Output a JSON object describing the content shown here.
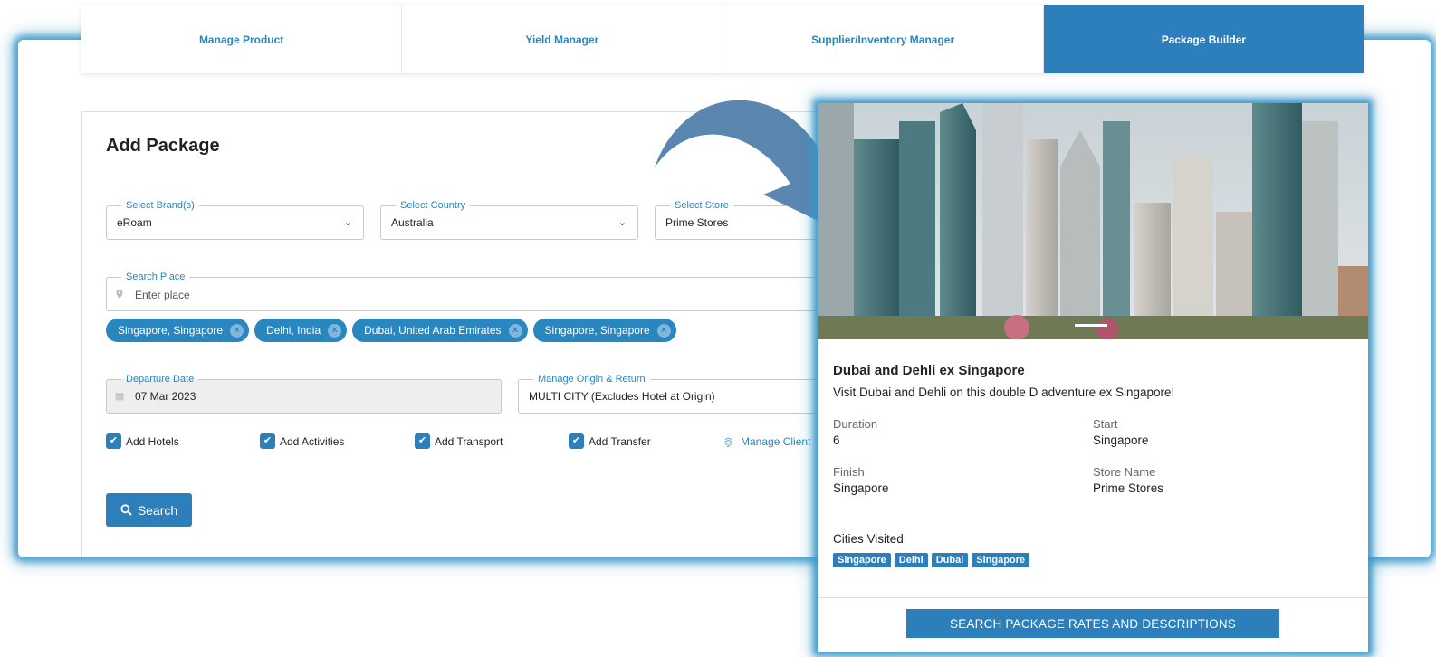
{
  "tabs": [
    {
      "label": "Manage Product"
    },
    {
      "label": "Yield Manager"
    },
    {
      "label": "Supplier/Inventory Manager"
    },
    {
      "label": "Package Builder",
      "active": true
    }
  ],
  "form": {
    "title": "Add Package",
    "brand": {
      "label": "Select Brand(s)",
      "value": "eRoam"
    },
    "country": {
      "label": "Select Country",
      "value": "Australia"
    },
    "store": {
      "label": "Select Store",
      "value": "Prime Stores"
    },
    "search_place": {
      "label": "Search Place",
      "placeholder": "Enter place"
    },
    "places": [
      "Singapore, Singapore",
      "Delhi, India",
      "Dubai, United Arab Emirates",
      "Singapore, Singapore"
    ],
    "departure": {
      "label": "Departure Date",
      "value": "07 Mar 2023"
    },
    "origin": {
      "label": "Manage Origin & Return",
      "value": "MULTI CITY (Excludes Hotel at Origin)"
    },
    "checks": [
      "Add Hotels",
      "Add Activities",
      "Add Transport",
      "Add Transfer"
    ],
    "manage_link": "Manage Client",
    "search_button": "Search"
  },
  "package_card": {
    "title": "Dubai and Dehli ex Singapore",
    "description": "Visit Dubai and Dehli on this double D adventure ex Singapore!",
    "duration_label": "Duration",
    "duration_value": "6",
    "start_label": "Start",
    "start_value": "Singapore",
    "finish_label": "Finish",
    "finish_value": "Singapore",
    "store_label": "Store Name",
    "store_value": "Prime Stores",
    "cities_label": "Cities Visited",
    "cities": [
      "Singapore",
      "Delhi",
      "Dubai",
      "Singapore"
    ],
    "cta": "SEARCH PACKAGE RATES AND DESCRIPTIONS"
  },
  "colors": {
    "accent": "#2c7fba",
    "glow": "#3696c8",
    "arrow": "#5a86b0"
  },
  "icons": [
    "chevron-down-icon",
    "map-pin-icon",
    "calendar-icon",
    "check-icon",
    "close-circle-icon",
    "search-icon",
    "fingerprint-icon",
    "arrow-icon"
  ]
}
